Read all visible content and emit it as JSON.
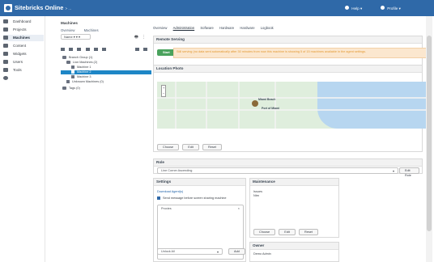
{
  "app": {
    "title": "Sitebricks Online",
    "subtitle": "> ...",
    "help_label": "Help ▾",
    "user_label": "Profile ▾"
  },
  "sidebar": {
    "items": [
      {
        "label": "Dashboard",
        "icon": "dashboard-icon"
      },
      {
        "label": "Projects",
        "icon": "projects-icon"
      },
      {
        "label": "Machines",
        "icon": "machines-icon"
      },
      {
        "label": "Content",
        "icon": "content-icon"
      },
      {
        "label": "Widgets",
        "icon": "widgets-icon"
      },
      {
        "label": "Users",
        "icon": "users-icon"
      },
      {
        "label": "Tools",
        "icon": "tools-icon"
      },
      {
        "label": "",
        "icon": "gear-icon"
      }
    ]
  },
  "tree": {
    "title": "Machines",
    "tabs": [
      "Overview",
      "Machines"
    ],
    "filter": "Name ▾ ▾ ▾",
    "nodes": [
      {
        "label": "Branch Group (1)",
        "level": 0
      },
      {
        "label": "Lion Machines (2)",
        "level": 1
      },
      {
        "label": "Machine 1",
        "level": 2
      },
      {
        "label": "Machine 2",
        "level": 2,
        "selected": true
      },
      {
        "label": "Machine 3",
        "level": 2
      },
      {
        "label": "Unknown Machines (0)",
        "level": 1
      },
      {
        "label": "Tags (0)",
        "level": 0
      }
    ]
  },
  "main": {
    "tabs": [
      "Overview",
      "Administration",
      "Software",
      "Hardware",
      "Hardware",
      "Logbook"
    ],
    "remote_serving": {
      "title": "Remote Serving",
      "button": "Start",
      "notice": "Still serving (no data sent automatically after 30 minutes from now this machine is showing 5 of 15 machines available in the agent settings."
    },
    "location": {
      "title": "Location Photo",
      "label_city": "Miami Beach",
      "label_port": "Port of Miami",
      "buttons": [
        "Choose",
        "Edit",
        "Reset"
      ]
    },
    "role": {
      "title": "Role",
      "value": "Line Corner Ascending",
      "button": "Edit Role"
    },
    "settings": {
      "title": "Settings",
      "link": "Download Agent(s)",
      "checkbox": "Send message before screen sharing machine",
      "input_placeholder": "Proxies",
      "bottom_select": "Unlock All",
      "bottom_button": "Add"
    },
    "maintenance": {
      "title": "Maintenance",
      "text_1": "Issues",
      "text_2": "Ntm",
      "buttons": [
        "Choose",
        "Edit",
        "Reset"
      ]
    },
    "owner": {
      "title": "Owner",
      "value": "Demo Admin"
    }
  }
}
